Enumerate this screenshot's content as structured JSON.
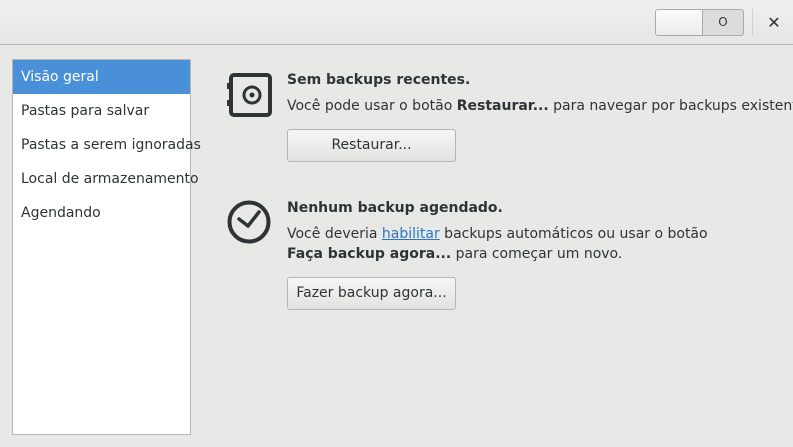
{
  "header": {
    "toggle_off_label": "O",
    "close_glyph": "✕",
    "close_icon": "close-icon"
  },
  "sidebar": {
    "items": [
      {
        "label": "Visão geral",
        "active": true
      },
      {
        "label": "Pastas para salvar",
        "active": false
      },
      {
        "label": "Pastas a serem ignoradas",
        "active": false
      },
      {
        "label": "Local de armazenamento",
        "active": false
      },
      {
        "label": "Agendando",
        "active": false
      }
    ]
  },
  "restore": {
    "icon": "safe-icon",
    "title": "Sem backups recentes.",
    "desc_pre": "Você pode usar o botão ",
    "desc_bold": "Restaurar...",
    "desc_post": " para navegar por backups existentes.",
    "button_label": "Restaurar..."
  },
  "schedule": {
    "icon": "clock-icon",
    "title": "Nenhum backup agendado.",
    "desc_pre": "Você deveria ",
    "desc_link": "habilitar",
    "desc_mid": " backups automáticos ou usar o botão ",
    "desc_bold": "Faça backup agora...",
    "desc_post": " para começar um novo.",
    "button_label": "Fazer backup agora..."
  },
  "colors": {
    "accent": "#4a90d9",
    "link": "#2a76c6",
    "background": "#e8e8e7"
  }
}
